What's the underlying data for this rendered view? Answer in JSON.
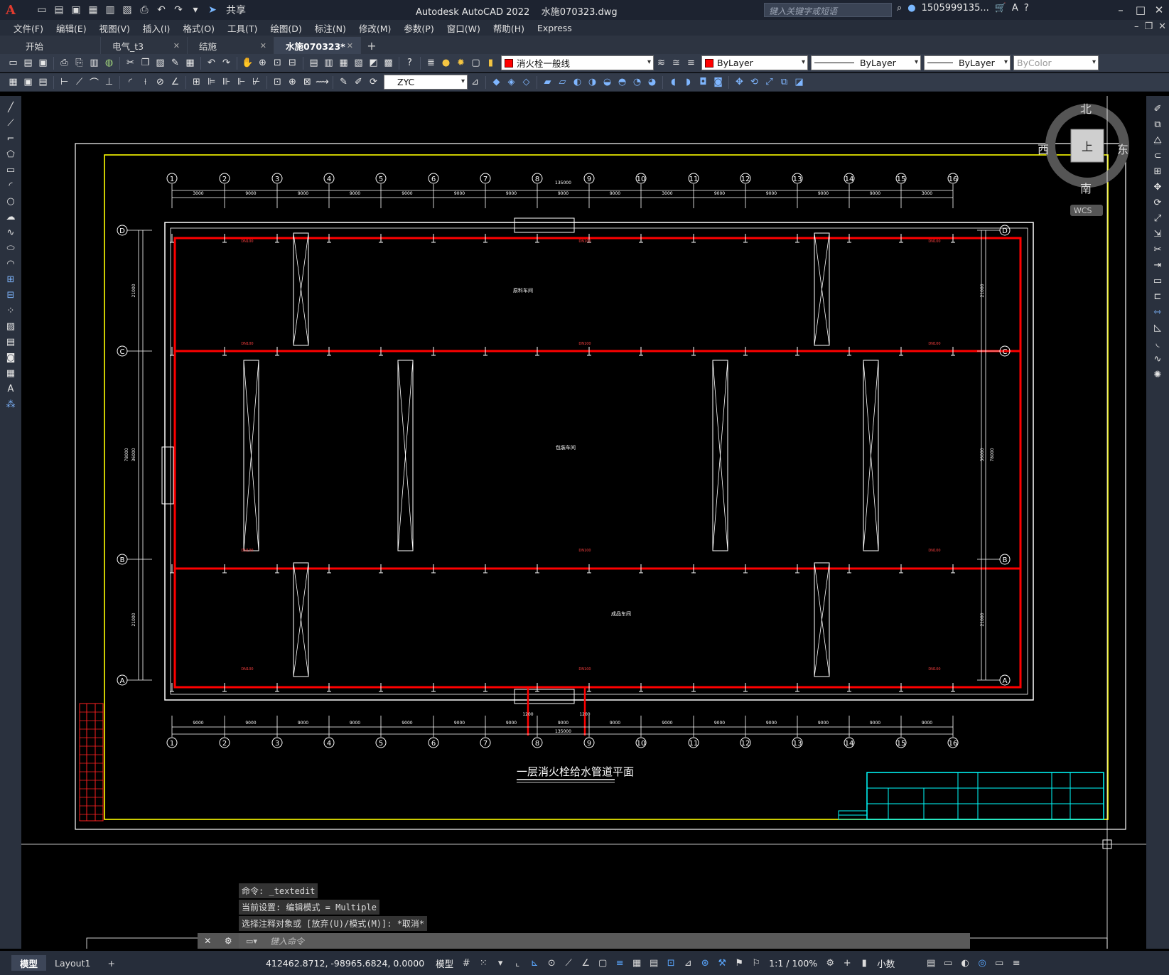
{
  "app": {
    "logo_letter": "A",
    "title": "Autodesk AutoCAD 2022",
    "filename": "水施070323.dwg",
    "share_label": "共享",
    "search_placeholder": "键入关键字或短语",
    "user": "1505999135..."
  },
  "menu": [
    "文件(F)",
    "编辑(E)",
    "视图(V)",
    "插入(I)",
    "格式(O)",
    "工具(T)",
    "绘图(D)",
    "标注(N)",
    "修改(M)",
    "参数(P)",
    "窗口(W)",
    "帮助(H)",
    "Express"
  ],
  "file_tabs": [
    {
      "label": "开始",
      "closable": false
    },
    {
      "label": "电气_t3",
      "closable": true
    },
    {
      "label": "结施",
      "closable": true
    },
    {
      "label": "水施070323*",
      "closable": true,
      "active": true
    }
  ],
  "properties": {
    "layer": "消火栓一般线",
    "color": "ByLayer",
    "linetype": "ByLayer",
    "lineweight": "ByLayer",
    "plotstyle": "ByColor",
    "textstyle": "ZYC"
  },
  "viewcube": {
    "north": "北",
    "south": "南",
    "east": "东",
    "west": "西",
    "face": "上",
    "wcs": "WCS"
  },
  "drawing": {
    "title": "一层消火栓给水管道平面",
    "grid_numbers": [
      "1",
      "2",
      "3",
      "4",
      "5",
      "6",
      "7",
      "8",
      "9",
      "10",
      "11",
      "12",
      "13",
      "14",
      "15",
      "16"
    ],
    "grid_letters": [
      "D",
      "C",
      "B",
      "A"
    ],
    "top_dims": [
      "3000",
      "9000",
      "9000",
      "9000",
      "9000",
      "9000",
      "9000",
      "9000",
      "9000",
      "3000",
      "9000",
      "9000",
      "9000",
      "9000",
      "3000"
    ],
    "bottom_dims": [
      "9000",
      "9000",
      "9000",
      "9000",
      "9000",
      "9000",
      "9000",
      "9000",
      "9000",
      "9000",
      "9000",
      "9000",
      "9000",
      "9000",
      "9000"
    ],
    "total_dim": "135000",
    "side_dims": [
      "21000",
      "36000",
      "21000"
    ],
    "side_total": "78000",
    "pipe_label": "DN100",
    "riser_dim": "1200",
    "rooms": [
      "原料车间",
      "包装车间",
      "成品车间"
    ]
  },
  "command_history": [
    "命令: _textedit",
    "当前设置: 编辑模式 = Multiple",
    "选择注释对象或 [放弃(U)/模式(M)]: *取消*"
  ],
  "command_placeholder": "键入命令",
  "status": {
    "tabs": [
      "模型",
      "Layout1"
    ],
    "coords": "412462.8712, -98965.6824, 0.0000",
    "space": "模型",
    "scale": "1:1 / 100%",
    "units": "小数"
  },
  "colors": {
    "pipe": "#ff0000",
    "border": "#ffff00",
    "titleblock": "#00ffff",
    "walls": "#ffffff"
  }
}
